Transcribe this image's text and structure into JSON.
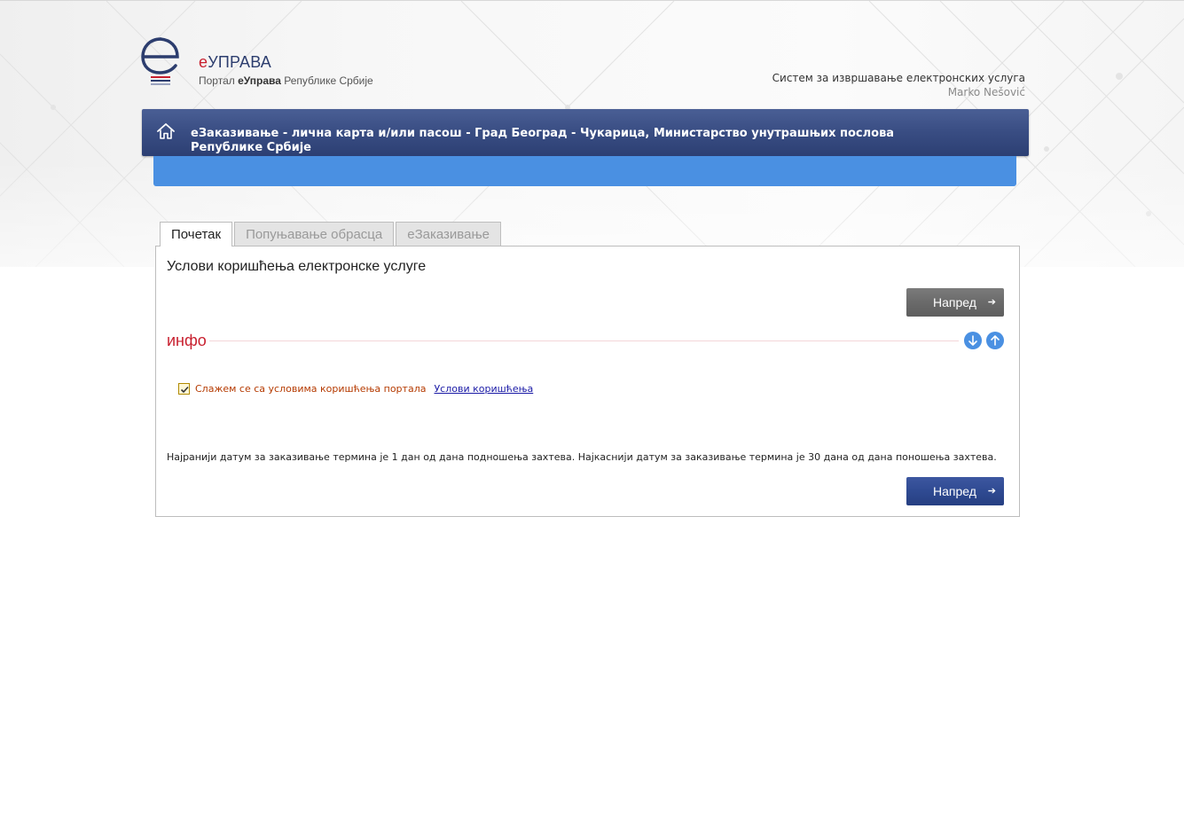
{
  "header": {
    "brand_prefix": "е",
    "brand_rest": "УПРАВА",
    "sub_prefix": "Портал ",
    "sub_bold": "еУправа",
    "sub_suffix": " Републике Србије",
    "system_title": "Систем за извршавање електронских услуга",
    "user_name": "Marko Nešović"
  },
  "service": {
    "title": "еЗаказивање - лична карта и/или пасош - Град Београд - Чукарица, Министарство унутрашњих послова Републике Србије"
  },
  "tabs": [
    {
      "label": "Почетак",
      "active": true
    },
    {
      "label": "Попуњавање обрасца",
      "active": false
    },
    {
      "label": "еЗаказивање",
      "active": false
    }
  ],
  "panel": {
    "title": "Услови коришћења електронске услуге",
    "next_top_label": "Напред",
    "info_label": "инфо",
    "agree_label": "Слажем се са условима коришћења портала",
    "agree_checked": true,
    "terms_link": "Услови коришћења",
    "note": "Најранији датум за заказивање термина је 1 дан од дана подношења захтева. Најкаснији датум за заказивање термина је 30 дана од дана поношења захтева.",
    "next_bottom_label": "Напред"
  },
  "colors": {
    "brand_red": "#c8202f",
    "brand_navy": "#2c3d6e",
    "band_blue": "#4a90e2"
  }
}
